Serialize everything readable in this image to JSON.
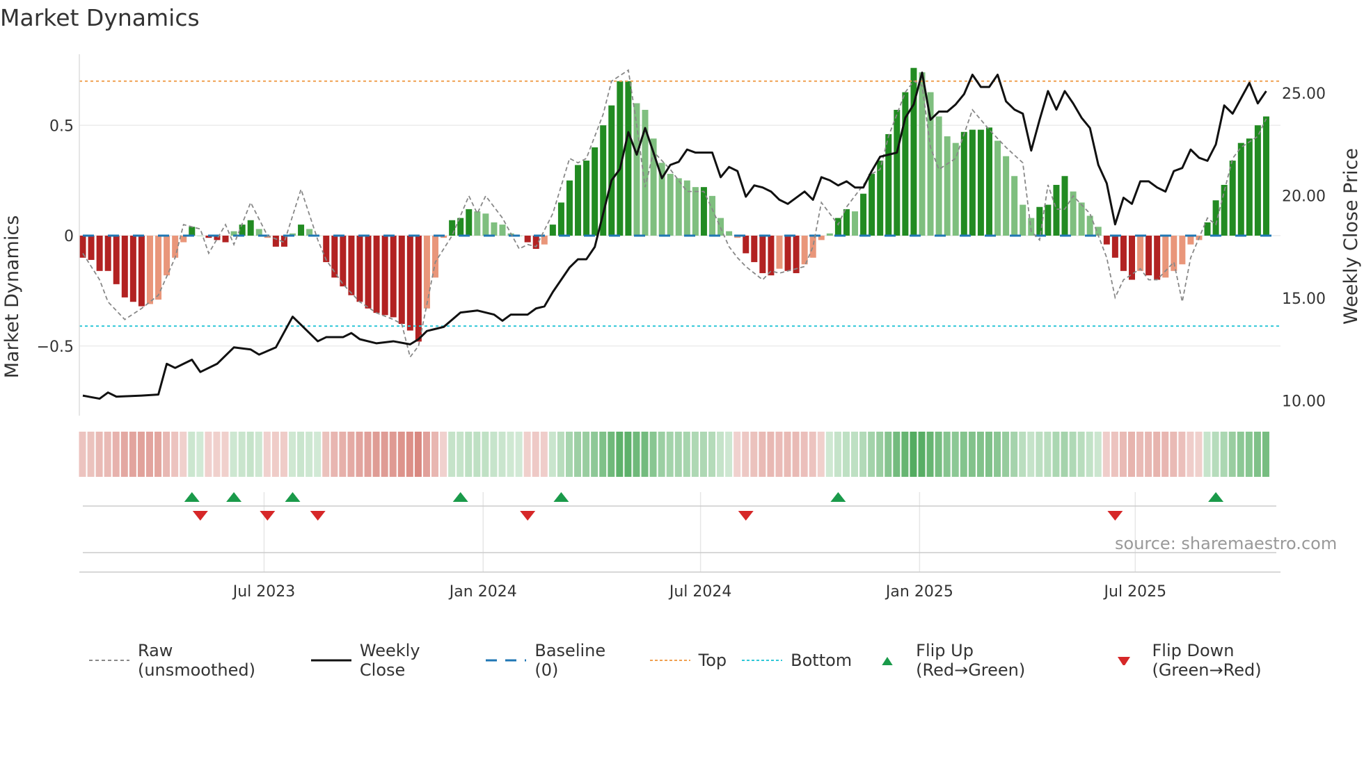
{
  "title": "Market Dynamics",
  "source": "source: sharemaestro.com",
  "legend": [
    {
      "label": "Raw (unsmoothed)",
      "icon": "gray-dashed-line"
    },
    {
      "label": "Weekly Close",
      "icon": "black-line"
    },
    {
      "label": "Baseline (0)",
      "icon": "blue-dashed-line"
    },
    {
      "label": "Top",
      "icon": "orange-dotted-line"
    },
    {
      "label": "Bottom",
      "icon": "cyan-dotted-line"
    },
    {
      "label": "Flip Up (Red→Green)",
      "icon": "green-triangle-up"
    },
    {
      "label": "Flip Down (Green→Red)",
      "icon": "red-triangle-down"
    }
  ],
  "colors": {
    "up_strong": "#228b22",
    "up_weak": "#7fbf7f",
    "down_strong": "#b22222",
    "down_weak": "#e9967a",
    "close": "#111111",
    "raw": "#888888",
    "baseline": "#1f77b4",
    "top": "#f0a050",
    "bottom": "#30c8d8",
    "flip_up": "#1a9a4a",
    "flip_down": "#d62728"
  },
  "chart_data": {
    "type": "bar",
    "title": "Market Dynamics",
    "ylabel": "Market Dynamics",
    "y2label": "Weekly Close Price",
    "x_unit": "weeks since start (weekly bars, ~Feb 2023 to Oct 2025)",
    "ylim": [
      -0.83,
      0.82
    ],
    "y2lim": [
      8.0,
      27.8
    ],
    "yticks": [
      {
        "v": 0.5,
        "label": "0.5"
      },
      {
        "v": 0,
        "label": "0"
      },
      {
        "v": -0.5,
        "label": "−0.5"
      }
    ],
    "y2ticks": [
      {
        "v": 25,
        "label": "25.00"
      },
      {
        "v": 20,
        "label": "20.00"
      },
      {
        "v": 15,
        "label": "15.00"
      },
      {
        "v": 10,
        "label": "10.00"
      }
    ],
    "xticks": [
      {
        "w": 21.6,
        "label": "Jul 2023"
      },
      {
        "w": 47.7,
        "label": "Jan 2024"
      },
      {
        "w": 73.6,
        "label": "Jul 2024"
      },
      {
        "w": 99.7,
        "label": "Jan 2025"
      },
      {
        "w": 125.4,
        "label": "Jul 2025"
      }
    ],
    "top": 0.7,
    "bottom": -0.41,
    "baseline": 0,
    "bars": [
      -0.1,
      -0.11,
      -0.16,
      -0.16,
      -0.22,
      -0.28,
      -0.3,
      -0.32,
      -0.31,
      -0.29,
      -0.18,
      -0.1,
      -0.03,
      0.04,
      0.0,
      -0.01,
      -0.02,
      -0.03,
      0.02,
      0.05,
      0.07,
      0.03,
      -0.01,
      -0.05,
      -0.05,
      0.01,
      0.05,
      0.03,
      0.0,
      -0.12,
      -0.19,
      -0.23,
      -0.27,
      -0.3,
      -0.33,
      -0.35,
      -0.36,
      -0.37,
      -0.4,
      -0.43,
      -0.48,
      -0.33,
      -0.19,
      -0.01,
      0.07,
      0.08,
      0.12,
      0.11,
      0.1,
      0.06,
      0.05,
      0.01,
      0.0,
      -0.03,
      -0.06,
      -0.04,
      0.05,
      0.15,
      0.25,
      0.32,
      0.34,
      0.4,
      0.5,
      0.59,
      0.7,
      0.7,
      0.6,
      0.57,
      0.44,
      0.33,
      0.28,
      0.26,
      0.25,
      0.22,
      0.22,
      0.18,
      0.08,
      0.02,
      -0.01,
      -0.08,
      -0.12,
      -0.17,
      -0.18,
      -0.15,
      -0.16,
      -0.17,
      -0.13,
      -0.1,
      -0.02,
      0.01,
      0.08,
      0.12,
      0.11,
      0.19,
      0.28,
      0.34,
      0.46,
      0.57,
      0.65,
      0.76,
      0.74,
      0.65,
      0.54,
      0.45,
      0.42,
      0.47,
      0.48,
      0.48,
      0.49,
      0.43,
      0.36,
      0.27,
      0.14,
      0.08,
      0.13,
      0.14,
      0.23,
      0.27,
      0.2,
      0.15,
      0.09,
      0.04,
      -0.04,
      -0.1,
      -0.16,
      -0.2,
      -0.16,
      -0.18,
      -0.2,
      -0.19,
      -0.16,
      -0.13,
      -0.04,
      -0.02,
      0.06,
      0.16,
      0.23,
      0.34,
      0.42,
      0.44,
      0.5,
      0.54
    ],
    "raw": [
      [
        0,
        -0.08
      ],
      [
        2,
        -0.2
      ],
      [
        3,
        -0.3
      ],
      [
        5,
        -0.38
      ],
      [
        7,
        -0.33
      ],
      [
        9,
        -0.27
      ],
      [
        11,
        -0.1
      ],
      [
        12,
        0.05
      ],
      [
        14,
        0.03
      ],
      [
        15,
        -0.08
      ],
      [
        17,
        0.05
      ],
      [
        18,
        -0.04
      ],
      [
        20,
        0.15
      ],
      [
        22,
        0.0
      ],
      [
        24,
        -0.03
      ],
      [
        26,
        0.21
      ],
      [
        28,
        -0.02
      ],
      [
        29,
        -0.11
      ],
      [
        31,
        -0.22
      ],
      [
        33,
        -0.3
      ],
      [
        35,
        -0.35
      ],
      [
        37,
        -0.38
      ],
      [
        38,
        -0.4
      ],
      [
        39,
        -0.55
      ],
      [
        40,
        -0.5
      ],
      [
        42,
        -0.12
      ],
      [
        44,
        0.0
      ],
      [
        46,
        0.18
      ],
      [
        47,
        0.1
      ],
      [
        48,
        0.18
      ],
      [
        50,
        0.08
      ],
      [
        52,
        -0.06
      ],
      [
        53,
        -0.04
      ],
      [
        54,
        -0.05
      ],
      [
        56,
        0.1
      ],
      [
        58,
        0.35
      ],
      [
        59,
        0.33
      ],
      [
        60,
        0.35
      ],
      [
        62,
        0.55
      ],
      [
        63,
        0.7
      ],
      [
        65,
        0.75
      ],
      [
        66,
        0.5
      ],
      [
        67,
        0.22
      ],
      [
        68,
        0.38
      ],
      [
        70,
        0.3
      ],
      [
        72,
        0.2
      ],
      [
        74,
        0.2
      ],
      [
        75,
        0.12
      ],
      [
        77,
        -0.05
      ],
      [
        78,
        -0.1
      ],
      [
        79,
        -0.14
      ],
      [
        81,
        -0.2
      ],
      [
        82,
        -0.16
      ],
      [
        83,
        -0.17
      ],
      [
        85,
        -0.15
      ],
      [
        86,
        -0.14
      ],
      [
        87,
        -0.05
      ],
      [
        88,
        0.15
      ],
      [
        89,
        0.1
      ],
      [
        90,
        0.05
      ],
      [
        91,
        0.13
      ],
      [
        92,
        0.18
      ],
      [
        94,
        0.28
      ],
      [
        95,
        0.3
      ],
      [
        96,
        0.45
      ],
      [
        97,
        0.55
      ],
      [
        98,
        0.65
      ],
      [
        99,
        0.7
      ],
      [
        100,
        0.68
      ],
      [
        101,
        0.4
      ],
      [
        102,
        0.3
      ],
      [
        104,
        0.35
      ],
      [
        106,
        0.57
      ],
      [
        108,
        0.48
      ],
      [
        110,
        0.4
      ],
      [
        112,
        0.33
      ],
      [
        113,
        0.02
      ],
      [
        114,
        -0.02
      ],
      [
        115,
        0.23
      ],
      [
        116,
        0.12
      ],
      [
        117,
        0.12
      ],
      [
        118,
        0.18
      ],
      [
        120,
        0.1
      ],
      [
        122,
        -0.1
      ],
      [
        123,
        -0.28
      ],
      [
        124,
        -0.2
      ],
      [
        126,
        -0.15
      ],
      [
        127,
        -0.2
      ],
      [
        128,
        -0.2
      ],
      [
        130,
        -0.12
      ],
      [
        131,
        -0.3
      ],
      [
        132,
        -0.1
      ],
      [
        134,
        0.08
      ],
      [
        135,
        0.05
      ],
      [
        137,
        0.35
      ],
      [
        138,
        0.4
      ],
      [
        140,
        0.45
      ],
      [
        141,
        0.53
      ]
    ],
    "close": [
      [
        0,
        10.25
      ],
      [
        2,
        10.1
      ],
      [
        3,
        10.4
      ],
      [
        4,
        10.2
      ],
      [
        7,
        10.25
      ],
      [
        9,
        10.3
      ],
      [
        10,
        11.8
      ],
      [
        11,
        11.6
      ],
      [
        12,
        11.8
      ],
      [
        13,
        12.0
      ],
      [
        14,
        11.4
      ],
      [
        16,
        11.8
      ],
      [
        18,
        12.6
      ],
      [
        20,
        12.5
      ],
      [
        21,
        12.25
      ],
      [
        23,
        12.6
      ],
      [
        25,
        14.1
      ],
      [
        26,
        13.7
      ],
      [
        28,
        12.9
      ],
      [
        29,
        13.1
      ],
      [
        31,
        13.1
      ],
      [
        32,
        13.3
      ],
      [
        33,
        13.0
      ],
      [
        35,
        12.8
      ],
      [
        37,
        12.9
      ],
      [
        39,
        12.75
      ],
      [
        40,
        13.0
      ],
      [
        41,
        13.4
      ],
      [
        42,
        13.5
      ],
      [
        43,
        13.6
      ],
      [
        45,
        14.3
      ],
      [
        47,
        14.4
      ],
      [
        49,
        14.2
      ],
      [
        50,
        13.9
      ],
      [
        51,
        14.2
      ],
      [
        53,
        14.2
      ],
      [
        54,
        14.5
      ],
      [
        55,
        14.6
      ],
      [
        56,
        15.3
      ],
      [
        58,
        16.5
      ],
      [
        59,
        16.9
      ],
      [
        60,
        16.9
      ],
      [
        61,
        17.5
      ],
      [
        63,
        20.75
      ],
      [
        64,
        21.3
      ],
      [
        65,
        23.1
      ],
      [
        66,
        22.0
      ],
      [
        67,
        23.3
      ],
      [
        68,
        22.1
      ],
      [
        69,
        20.85
      ],
      [
        70,
        21.5
      ],
      [
        71,
        21.65
      ],
      [
        72,
        22.25
      ],
      [
        73,
        22.1
      ],
      [
        75,
        22.1
      ],
      [
        76,
        20.9
      ],
      [
        77,
        21.4
      ],
      [
        78,
        21.2
      ],
      [
        79,
        19.95
      ],
      [
        80,
        20.5
      ],
      [
        81,
        20.4
      ],
      [
        82,
        20.2
      ],
      [
        83,
        19.8
      ],
      [
        84,
        19.6
      ],
      [
        85,
        19.9
      ],
      [
        86,
        20.2
      ],
      [
        87,
        19.8
      ],
      [
        88,
        20.9
      ],
      [
        89,
        20.75
      ],
      [
        90,
        20.5
      ],
      [
        91,
        20.7
      ],
      [
        92,
        20.4
      ],
      [
        93,
        20.4
      ],
      [
        94,
        21.2
      ],
      [
        95,
        21.9
      ],
      [
        96,
        22.0
      ],
      [
        97,
        22.1
      ],
      [
        98,
        23.8
      ],
      [
        99,
        24.45
      ],
      [
        100,
        26.0
      ],
      [
        101,
        23.7
      ],
      [
        102,
        24.1
      ],
      [
        103,
        24.1
      ],
      [
        104,
        24.45
      ],
      [
        105,
        24.95
      ],
      [
        106,
        25.9
      ],
      [
        107,
        25.3
      ],
      [
        108,
        25.3
      ],
      [
        109,
        25.9
      ],
      [
        110,
        24.6
      ],
      [
        111,
        24.2
      ],
      [
        112,
        24.0
      ],
      [
        113,
        22.2
      ],
      [
        114,
        23.7
      ],
      [
        115,
        25.1
      ],
      [
        116,
        24.2
      ],
      [
        117,
        25.1
      ],
      [
        118,
        24.5
      ],
      [
        119,
        23.8
      ],
      [
        120,
        23.3
      ],
      [
        121,
        21.5
      ],
      [
        122,
        20.6
      ],
      [
        123,
        18.6
      ],
      [
        124,
        19.9
      ],
      [
        125,
        19.6
      ],
      [
        126,
        20.7
      ],
      [
        127,
        20.7
      ],
      [
        128,
        20.4
      ],
      [
        129,
        20.2
      ],
      [
        130,
        21.2
      ],
      [
        131,
        21.35
      ],
      [
        132,
        22.25
      ],
      [
        133,
        21.85
      ],
      [
        134,
        21.7
      ],
      [
        135,
        22.5
      ],
      [
        136,
        24.4
      ],
      [
        137,
        24.0
      ],
      [
        138,
        24.75
      ],
      [
        139,
        25.5
      ],
      [
        140,
        24.5
      ],
      [
        141,
        25.1
      ]
    ],
    "flip_up": [
      13,
      18,
      25,
      45,
      57,
      90,
      135
    ],
    "flip_down": [
      14,
      22,
      28,
      53,
      79,
      123
    ]
  }
}
